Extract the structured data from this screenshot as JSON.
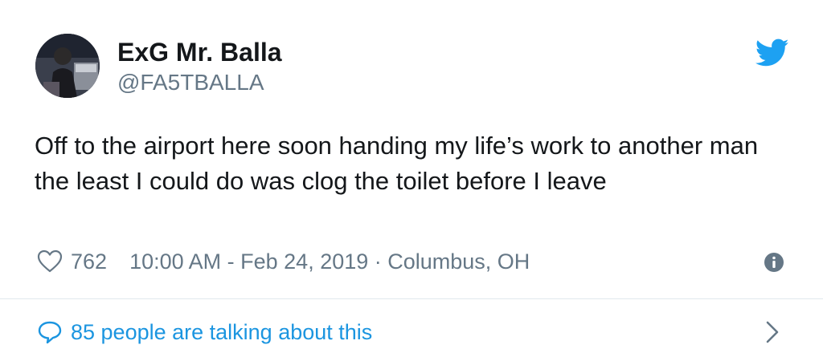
{
  "user": {
    "display_name": "ExG Mr. Balla",
    "handle": "@FA5TBALLA",
    "avatar_icon": "profile-photo"
  },
  "tweet": {
    "text": "Off to the airport here soon handing my life’s work to another man the least I could do was clog the toilet before I leave"
  },
  "meta": {
    "likes": "762",
    "timestamp": "10:00 AM - Feb 24, 2019 · Columbus, OH"
  },
  "footer": {
    "talking_label": "85 people are talking about this"
  },
  "icons": {
    "brand": "twitter-bird-icon",
    "like": "heart-icon",
    "info": "info-icon",
    "reply": "speech-bubble-icon",
    "more": "chevron-right-icon"
  },
  "colors": {
    "brand_blue": "#1da1f2",
    "link_blue": "#1b95e0",
    "secondary_text": "#657786",
    "primary_text": "#14171a",
    "divider": "#e1e8ed"
  }
}
